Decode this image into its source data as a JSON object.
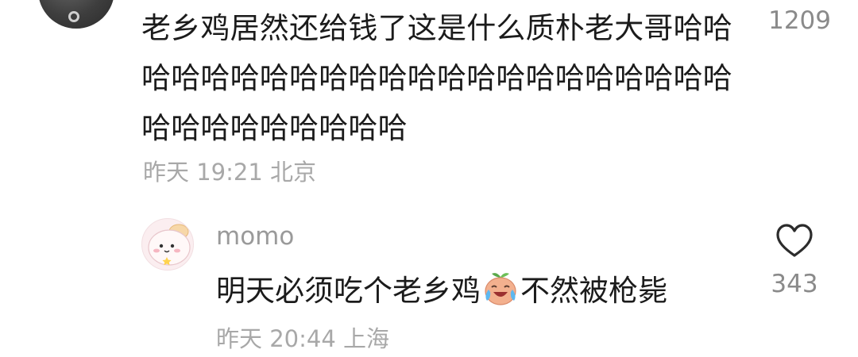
{
  "comment": {
    "text": "老乡鸡居然还给钱了这是什么质朴老大哥哈哈哈哈哈哈哈哈哈哈哈哈哈哈哈哈哈哈哈哈哈哈哈哈哈哈哈哈哈哈哈",
    "meta": "昨天 19:21 北京",
    "like_count": "1209"
  },
  "reply": {
    "username": "momo",
    "text_before": "明天必须吃个老乡鸡",
    "emoji": "crying-laughing-face-emoji",
    "text_after": "不然被枪毙",
    "meta": "昨天 20:44 上海",
    "like_count": "343"
  },
  "colors": {
    "text_primary": "#1b1b1b",
    "text_secondary": "#a8a8a8",
    "like_count": "#8a8a8a"
  }
}
